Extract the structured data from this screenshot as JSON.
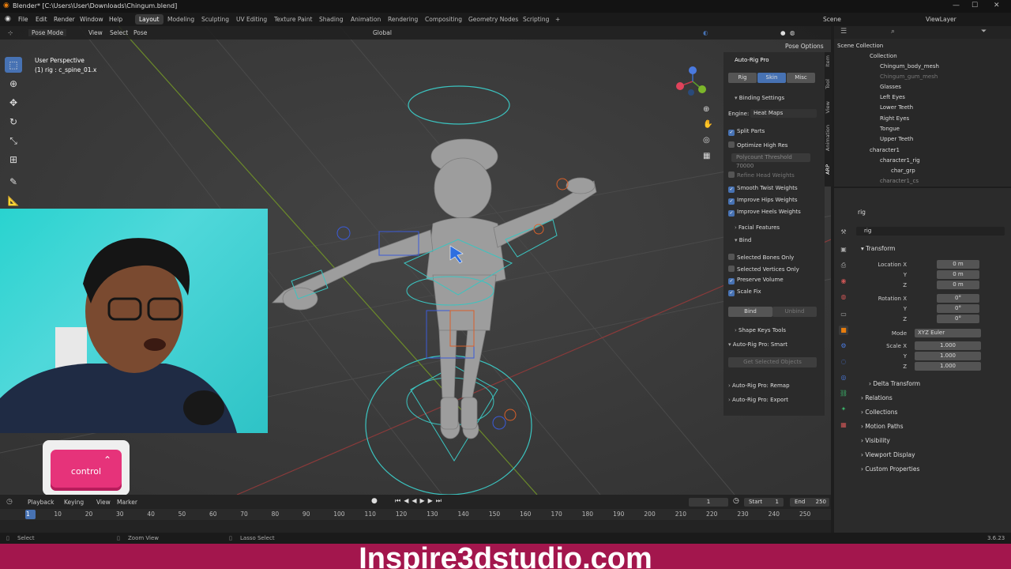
{
  "window": {
    "title": "Blender* [C:\\Users\\User\\Downloads\\Chingum.blend]",
    "ctrl_min": "—",
    "ctrl_max": "☐",
    "ctrl_close": "✕"
  },
  "menu": [
    "File",
    "Edit",
    "Render",
    "Window",
    "Help"
  ],
  "workspaces": [
    "Layout",
    "Modeling",
    "Sculpting",
    "UV Editing",
    "Texture Paint",
    "Shading",
    "Animation",
    "Rendering",
    "Compositing",
    "Geometry Nodes",
    "Scripting"
  ],
  "workspaces_add": "+",
  "scene": {
    "label": "Scene",
    "viewlayer": "ViewLayer"
  },
  "viewport_header": {
    "mode": "Pose Mode",
    "items": [
      "View",
      "Select",
      "Pose"
    ],
    "orientation": "Global",
    "pose_options": "Pose Options"
  },
  "viewport": {
    "perspective": "User Perspective",
    "object_info": "(1) rig : c_spine_01.x"
  },
  "npanel": {
    "title": "Auto-Rig Pro",
    "tabs": [
      "Rig",
      "Skin",
      "Misc"
    ],
    "active_tab": "Skin",
    "binding_settings": "Binding Settings",
    "engine_label": "Engine:",
    "engine_value": "Heat Maps",
    "split_parts": "Split Parts",
    "optimize_high_res": "Optimize High Res",
    "polycount_threshold": "Polycount Threshold",
    "polycount_value": "70000",
    "refine_head_weights": "Refine Head Weights",
    "smooth_twist": "Smooth Twist Weights",
    "improve_hips": "Improve Hips Weights",
    "improve_heels": "Improve Heels Weights",
    "facial_features": "Facial Features",
    "bind_section": "Bind",
    "selected_bones_only": "Selected Bones Only",
    "selected_vertices_only": "Selected Vertices Only",
    "preserve_volume": "Preserve Volume",
    "scale_fix": "Scale Fix",
    "bind_button": "Bind",
    "unbind_button": "Unbind",
    "shape_keys_tools": "Shape Keys Tools",
    "smart": "Auto-Rig Pro: Smart",
    "get_selected_objects": "Get Selected Objects",
    "remap": "Auto-Rig Pro: Remap",
    "export": "Auto-Rig Pro: Export",
    "vertical_tabs": [
      "Item",
      "Tool",
      "View",
      "Animation",
      "ARP"
    ]
  },
  "outliner": {
    "items": [
      {
        "label": "Scene Collection",
        "indent": 0
      },
      {
        "label": "Collection",
        "indent": 1
      },
      {
        "label": "Chingum_body_mesh",
        "indent": 2
      },
      {
        "label": "Chingum_gum_mesh",
        "indent": 2
      },
      {
        "label": "Glasses",
        "indent": 2
      },
      {
        "label": "Left Eyes",
        "indent": 2
      },
      {
        "label": "Lower Teeth",
        "indent": 2
      },
      {
        "label": "Right Eyes",
        "indent": 2
      },
      {
        "label": "Tongue",
        "indent": 2
      },
      {
        "label": "Upper Teeth",
        "indent": 2
      },
      {
        "label": "character1",
        "indent": 1
      },
      {
        "label": "character1_rig",
        "indent": 2
      },
      {
        "label": "char_grp",
        "indent": 3
      },
      {
        "label": "character1_cs",
        "indent": 2
      }
    ]
  },
  "properties": {
    "object_name": "rig",
    "data_name": "rig",
    "transform": "Transform",
    "location_label": "Location X",
    "location": [
      "0 m",
      "0 m",
      "0 m"
    ],
    "rotation_label": "Rotation X",
    "rotation": [
      "0°",
      "0°",
      "0°"
    ],
    "mode_label": "Mode",
    "mode_value": "XYZ Euler",
    "scale_label": "Scale X",
    "scale": [
      "1.000",
      "1.000",
      "1.000"
    ],
    "axis_y": "Y",
    "axis_z": "Z",
    "sections": [
      "Delta Transform",
      "Relations",
      "Collections",
      "Motion Paths",
      "Visibility",
      "Viewport Display",
      "Custom Properties"
    ]
  },
  "timeline": {
    "menus": [
      "Playback",
      "Keying",
      "View",
      "Marker"
    ],
    "current_frame": "1",
    "start_label": "Start",
    "start": "1",
    "end_label": "End",
    "end": "250",
    "ticks": [
      "1",
      "10",
      "20",
      "30",
      "40",
      "50",
      "60",
      "70",
      "80",
      "90",
      "100",
      "110",
      "120",
      "130",
      "140",
      "150",
      "160",
      "170",
      "180",
      "190",
      "200",
      "210",
      "220",
      "230",
      "240",
      "250"
    ]
  },
  "status": {
    "select": "Select",
    "zoom": "Zoom View",
    "lasso": "Lasso Select",
    "version": "3.6.23"
  },
  "overlay": {
    "key_label": "control",
    "key_arrow": "⌃",
    "brand": "Inspire3dstudio.com"
  },
  "colors": {
    "accent": "#4772b3",
    "brand": "#a3164d",
    "key": "#e6337a",
    "webcam_bg": "#29d3cf"
  }
}
